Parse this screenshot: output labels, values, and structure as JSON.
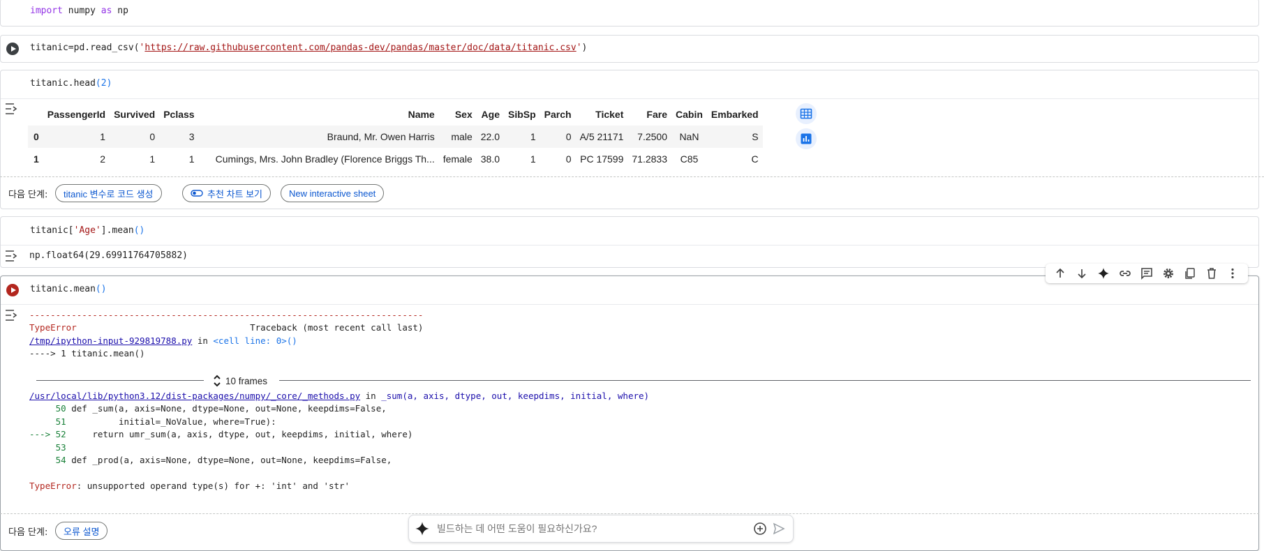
{
  "cells": {
    "c1": {
      "keyword1": "import",
      "module": " numpy ",
      "keyword2": "as",
      "alias": " np"
    },
    "c2": {
      "prefix": "titanic=pd.read_csv(",
      "quote_open": "'",
      "url": "https://raw.githubusercontent.com/pandas-dev/pandas/master/doc/data/titanic.csv",
      "quote_close": "'",
      "paren_close": ")"
    },
    "c3": {
      "code_prefix": "titanic.head",
      "paren": "(2)"
    },
    "c4": {
      "code_prefix": "titanic[",
      "string": "'Age'",
      "code_mid": "].mean",
      "paren": "()",
      "output": "np.float64(29.69911764705882)"
    },
    "c5": {
      "code_prefix": "titanic.mean",
      "paren": "()"
    }
  },
  "dataframe": {
    "columns": [
      "",
      "PassengerId",
      "Survived",
      "Pclass",
      "Name",
      "Sex",
      "Age",
      "SibSp",
      "Parch",
      "Ticket",
      "Fare",
      "Cabin",
      "Embarked"
    ],
    "rows": [
      [
        "0",
        "1",
        "0",
        "3",
        "Braund, Mr. Owen Harris",
        "male",
        "22.0",
        "1",
        "0",
        "A/5 21171",
        "7.2500",
        "NaN",
        "S"
      ],
      [
        "1",
        "2",
        "1",
        "1",
        "Cumings, Mrs. John Bradley (Florence Briggs Th...",
        "female",
        "38.0",
        "1",
        "0",
        "PC 17599",
        "71.2833",
        "C85",
        "C"
      ]
    ]
  },
  "next_steps": {
    "label": "다음 단계:",
    "chip_generate": "titanic 변수로 코드 생성",
    "chip_chart": "추천 차트 보기",
    "chip_sheet": "New interactive sheet",
    "chip_explain": "오류 설명"
  },
  "traceback": {
    "dashes": "---------------------------------------------------------------------------",
    "error_name": "TypeError",
    "header_right": "                                 Traceback (most recent call last)",
    "file1": "/tmp/ipython-input-929819788.py",
    "in_word": " in ",
    "cell_ref": "<cell line: 0>",
    "cell_paren": "()",
    "arrow_line": "----> 1 titanic.mean()",
    "frames": "10 frames",
    "file2": "/usr/local/lib/python3.12/dist-packages/numpy/_core/_methods.py",
    "func2": "_sum(a, axis, dtype, out, keepdims, initial, where)",
    "l50_num": "     50",
    "l50_code": " def _sum(a, axis=None, dtype=None, out=None, keepdims=False,",
    "l51_num": "     51",
    "l51_code": "          initial=_NoValue, where=True):",
    "l52_arrow": "---> 52",
    "l52_code": "     return umr_sum(a, axis, dtype, out, keepdims, initial, where)",
    "l53_num": "     53",
    "l54_num": "     54",
    "l54_code": " def _prod(a, axis=None, dtype=None, out=None, keepdims=False,",
    "error_msg": ": unsupported operand type(s) for +: 'int' and 'str'"
  },
  "prompt": {
    "placeholder": "빌드하는 데 어떤 도움이 필요하신가요?"
  },
  "colors": {
    "accent": "#1a73e8",
    "error": "#b3261e",
    "chip_text": "#0b57d0"
  }
}
